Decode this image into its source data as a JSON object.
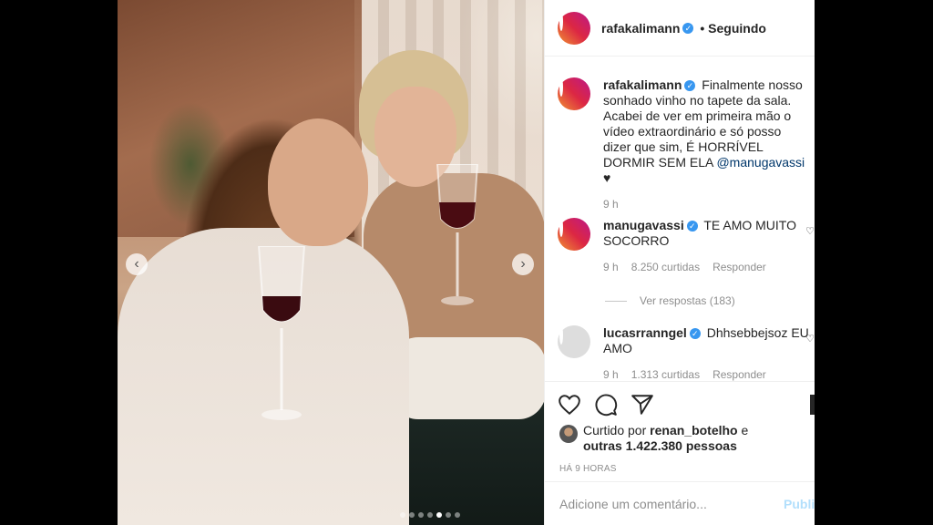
{
  "post": {
    "author": "rafakalimann",
    "follow_status": "• Seguindo",
    "caption_author": "rafakalimann",
    "caption_text": "Finalmente nosso sonhado vinho no tapete da sala. Acabei de ver em primeira mão o vídeo extraordinário e só posso dizer que sim, É HORRÍVEL DORMIR SEM ELA ",
    "caption_mention": "@manugavassi",
    "caption_end": " ♥",
    "caption_time": "9 h"
  },
  "comments": [
    {
      "username": "manugavassi",
      "text": "TE AMO MUITO SOCORRO",
      "time": "9 h",
      "likes": "8.250 curtidas",
      "reply": "Responder"
    },
    {
      "username": "lucasrranngel",
      "text": "Dhhsebbejsoz EU AMO",
      "time": "9 h",
      "likes": "1.313 curtidas",
      "reply": "Responder"
    }
  ],
  "view_replies": "Ver respostas (183)",
  "likes": {
    "prefix": "Curtido por",
    "user": "renan_botelho",
    "mid": "e",
    "others": "outras 1.422.380 pessoas"
  },
  "timestamp": "HÁ 9 HORAS",
  "add_comment": {
    "placeholder": "Adicione um comentário...",
    "publish": "Publi"
  },
  "carousel": {
    "prev": "‹",
    "next": "›",
    "dots": 7,
    "active": 4
  },
  "colors": {
    "verified": "#3897f0",
    "link": "#00376b",
    "publish_disabled": "#b2dffc"
  }
}
